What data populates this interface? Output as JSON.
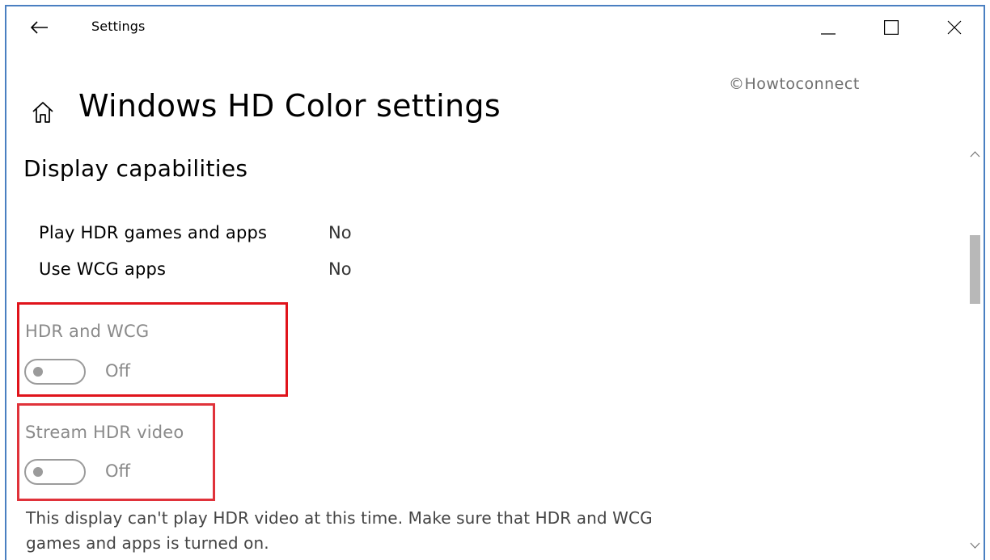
{
  "window": {
    "title": "Settings",
    "controls": {
      "minimize": "minimize-icon",
      "maximize": "maximize-icon",
      "close": "close-icon"
    }
  },
  "watermark": "©Howtoconnect",
  "page": {
    "title": "Windows HD Color settings",
    "section_title": "Display capabilities"
  },
  "capabilities": [
    {
      "label": "Play HDR games and apps",
      "value": "No"
    },
    {
      "label": "Use WCG apps",
      "value": "No"
    }
  ],
  "settings": [
    {
      "label": "HDR and WCG",
      "state": "Off",
      "enabled": false,
      "on": false
    },
    {
      "label": "Stream HDR video",
      "state": "Off",
      "enabled": false,
      "on": false
    }
  ],
  "note": "This display can't play HDR video at this time. Make sure that HDR and WCG games and apps is turned on.",
  "colors": {
    "highlight": "#e0131b",
    "window_border": "#4a7fc1",
    "disabled_text": "#8a8a8a"
  }
}
